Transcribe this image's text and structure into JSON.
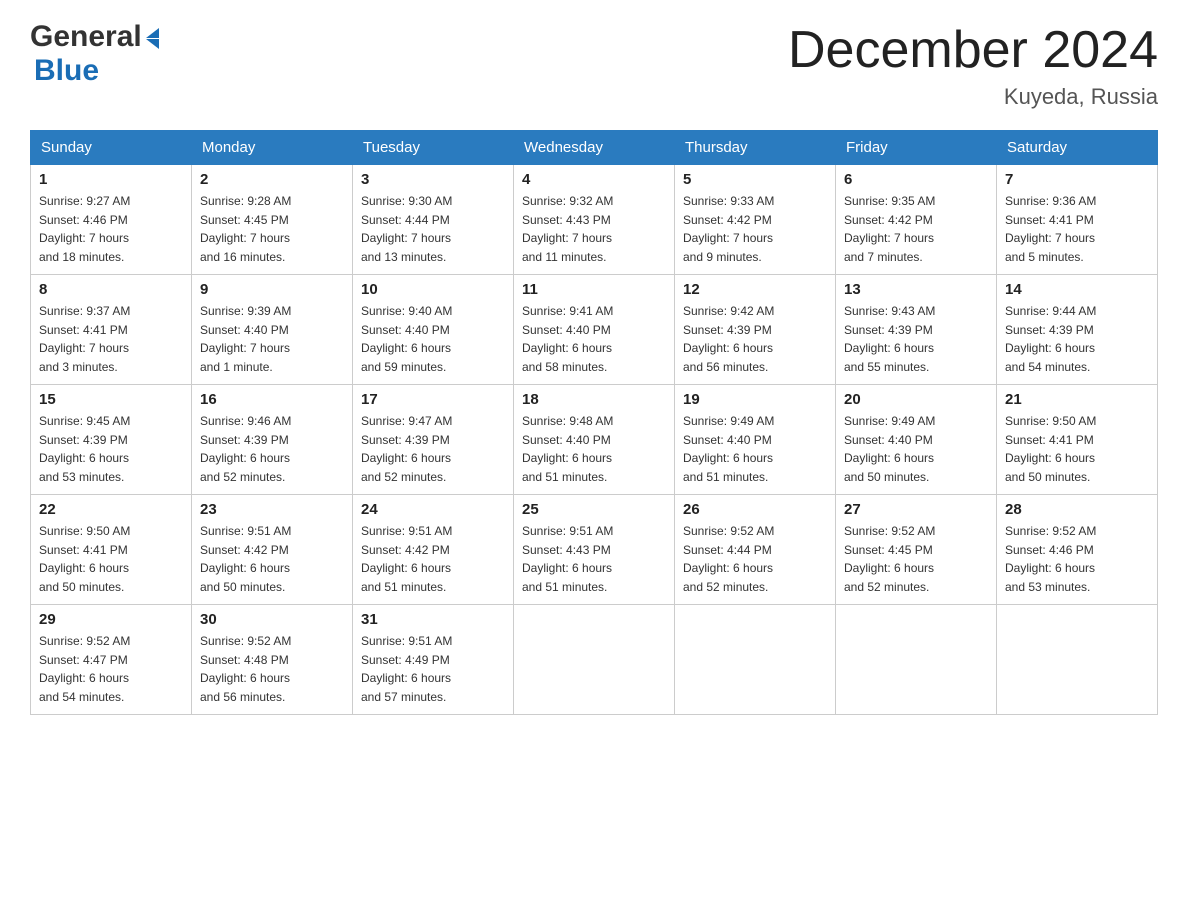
{
  "logo": {
    "general": "General",
    "blue": "Blue",
    "arrow": "▶"
  },
  "title": "December 2024",
  "subtitle": "Kuyeda, Russia",
  "weekdays": [
    "Sunday",
    "Monday",
    "Tuesday",
    "Wednesday",
    "Thursday",
    "Friday",
    "Saturday"
  ],
  "weeks": [
    [
      {
        "day": "1",
        "sunrise": "9:27 AM",
        "sunset": "4:46 PM",
        "daylight": "7 hours and 18 minutes."
      },
      {
        "day": "2",
        "sunrise": "9:28 AM",
        "sunset": "4:45 PM",
        "daylight": "7 hours and 16 minutes."
      },
      {
        "day": "3",
        "sunrise": "9:30 AM",
        "sunset": "4:44 PM",
        "daylight": "7 hours and 13 minutes."
      },
      {
        "day": "4",
        "sunrise": "9:32 AM",
        "sunset": "4:43 PM",
        "daylight": "7 hours and 11 minutes."
      },
      {
        "day": "5",
        "sunrise": "9:33 AM",
        "sunset": "4:42 PM",
        "daylight": "7 hours and 9 minutes."
      },
      {
        "day": "6",
        "sunrise": "9:35 AM",
        "sunset": "4:42 PM",
        "daylight": "7 hours and 7 minutes."
      },
      {
        "day": "7",
        "sunrise": "9:36 AM",
        "sunset": "4:41 PM",
        "daylight": "7 hours and 5 minutes."
      }
    ],
    [
      {
        "day": "8",
        "sunrise": "9:37 AM",
        "sunset": "4:41 PM",
        "daylight": "7 hours and 3 minutes."
      },
      {
        "day": "9",
        "sunrise": "9:39 AM",
        "sunset": "4:40 PM",
        "daylight": "7 hours and 1 minute."
      },
      {
        "day": "10",
        "sunrise": "9:40 AM",
        "sunset": "4:40 PM",
        "daylight": "6 hours and 59 minutes."
      },
      {
        "day": "11",
        "sunrise": "9:41 AM",
        "sunset": "4:40 PM",
        "daylight": "6 hours and 58 minutes."
      },
      {
        "day": "12",
        "sunrise": "9:42 AM",
        "sunset": "4:39 PM",
        "daylight": "6 hours and 56 minutes."
      },
      {
        "day": "13",
        "sunrise": "9:43 AM",
        "sunset": "4:39 PM",
        "daylight": "6 hours and 55 minutes."
      },
      {
        "day": "14",
        "sunrise": "9:44 AM",
        "sunset": "4:39 PM",
        "daylight": "6 hours and 54 minutes."
      }
    ],
    [
      {
        "day": "15",
        "sunrise": "9:45 AM",
        "sunset": "4:39 PM",
        "daylight": "6 hours and 53 minutes."
      },
      {
        "day": "16",
        "sunrise": "9:46 AM",
        "sunset": "4:39 PM",
        "daylight": "6 hours and 52 minutes."
      },
      {
        "day": "17",
        "sunrise": "9:47 AM",
        "sunset": "4:39 PM",
        "daylight": "6 hours and 52 minutes."
      },
      {
        "day": "18",
        "sunrise": "9:48 AM",
        "sunset": "4:40 PM",
        "daylight": "6 hours and 51 minutes."
      },
      {
        "day": "19",
        "sunrise": "9:49 AM",
        "sunset": "4:40 PM",
        "daylight": "6 hours and 51 minutes."
      },
      {
        "day": "20",
        "sunrise": "9:49 AM",
        "sunset": "4:40 PM",
        "daylight": "6 hours and 50 minutes."
      },
      {
        "day": "21",
        "sunrise": "9:50 AM",
        "sunset": "4:41 PM",
        "daylight": "6 hours and 50 minutes."
      }
    ],
    [
      {
        "day": "22",
        "sunrise": "9:50 AM",
        "sunset": "4:41 PM",
        "daylight": "6 hours and 50 minutes."
      },
      {
        "day": "23",
        "sunrise": "9:51 AM",
        "sunset": "4:42 PM",
        "daylight": "6 hours and 50 minutes."
      },
      {
        "day": "24",
        "sunrise": "9:51 AM",
        "sunset": "4:42 PM",
        "daylight": "6 hours and 51 minutes."
      },
      {
        "day": "25",
        "sunrise": "9:51 AM",
        "sunset": "4:43 PM",
        "daylight": "6 hours and 51 minutes."
      },
      {
        "day": "26",
        "sunrise": "9:52 AM",
        "sunset": "4:44 PM",
        "daylight": "6 hours and 52 minutes."
      },
      {
        "day": "27",
        "sunrise": "9:52 AM",
        "sunset": "4:45 PM",
        "daylight": "6 hours and 52 minutes."
      },
      {
        "day": "28",
        "sunrise": "9:52 AM",
        "sunset": "4:46 PM",
        "daylight": "6 hours and 53 minutes."
      }
    ],
    [
      {
        "day": "29",
        "sunrise": "9:52 AM",
        "sunset": "4:47 PM",
        "daylight": "6 hours and 54 minutes."
      },
      {
        "day": "30",
        "sunrise": "9:52 AM",
        "sunset": "4:48 PM",
        "daylight": "6 hours and 56 minutes."
      },
      {
        "day": "31",
        "sunrise": "9:51 AM",
        "sunset": "4:49 PM",
        "daylight": "6 hours and 57 minutes."
      },
      null,
      null,
      null,
      null
    ]
  ],
  "labels": {
    "sunrise": "Sunrise:",
    "sunset": "Sunset:",
    "daylight": "Daylight:"
  }
}
